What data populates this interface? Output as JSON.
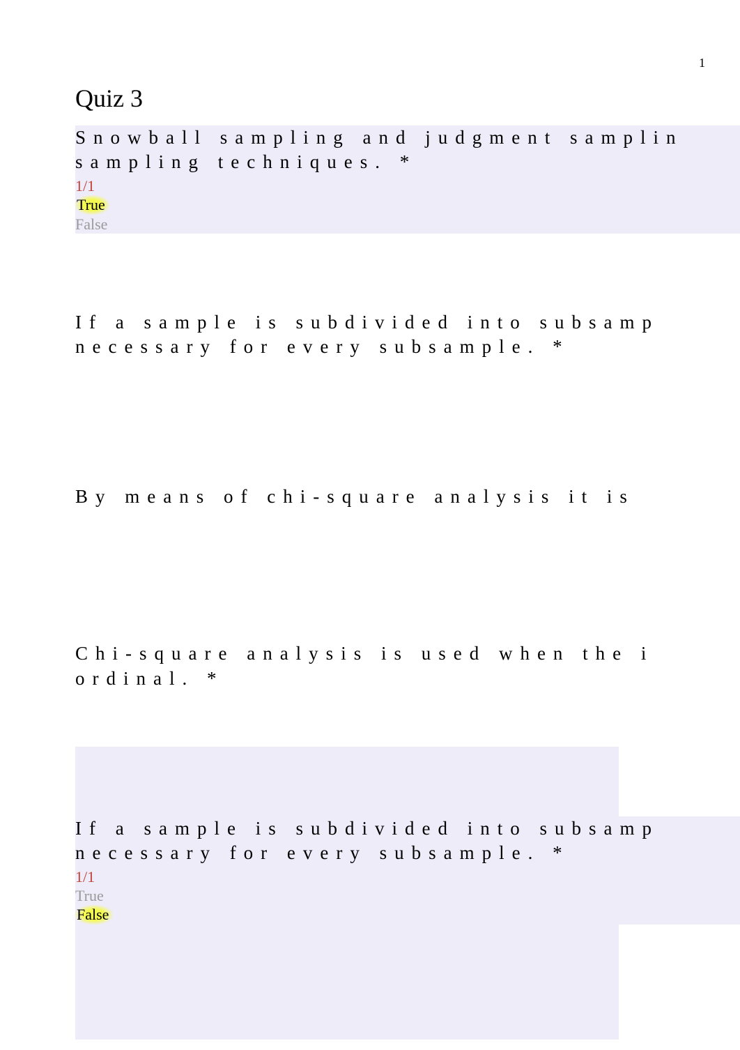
{
  "page_number": "1",
  "title": "Quiz 3",
  "questions": {
    "q1": {
      "line1": "Snowball sampling and judgment samplin",
      "line2": "sampling techniques. *",
      "score": "1/1",
      "true": "True",
      "false": "False"
    },
    "q2": {
      "line1": "If a sample is subdivided into subsamp",
      "line2": "necessary for every subsample. *"
    },
    "q3": {
      "line1": "By means of chi-square analysis it is"
    },
    "q4": {
      "line1": "Chi-square analysis is used when the i",
      "line2": "ordinal. *"
    },
    "q5": {
      "line1": "If a sample is subdivided into subsamp",
      "line2": "necessary for every subsample. *",
      "score": "1/1",
      "true": "True",
      "false": "False"
    }
  }
}
